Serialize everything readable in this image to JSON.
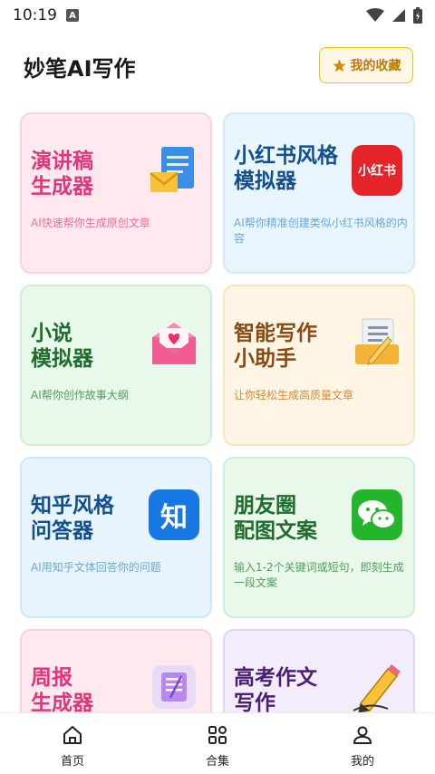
{
  "status_bar": {
    "time": "10:19",
    "notification_letter": "A"
  },
  "header": {
    "title": "妙笔AI写作",
    "favorites_label": "我的收藏"
  },
  "cards": [
    {
      "title": "演讲稿\n生成器",
      "desc": "AI快速帮你生成原创文章",
      "icon": "document-envelope-icon"
    },
    {
      "title": "小红书风格模拟器",
      "desc": "AI帮你精准创建类似小红书风格的内容",
      "icon": "xiaohongshu-icon",
      "icon_text": "小红书"
    },
    {
      "title": "小说\n模拟器",
      "desc": "AI帮你创作故事大纲",
      "icon": "love-letter-icon"
    },
    {
      "title": "智能写作\n小助手",
      "desc": "让你轻松生成高质量文章",
      "icon": "notepad-pencil-icon"
    },
    {
      "title": "知乎风格\n问答器",
      "desc": "AI用知乎文体回答你的问题",
      "icon": "zhihu-icon",
      "icon_text": "知"
    },
    {
      "title": "朋友圈\n配图文案",
      "desc": "输入1-2个关键词或短句，即刻生成一段文案",
      "icon": "wechat-icon"
    },
    {
      "title": "周报\n生成器",
      "desc": "",
      "icon": "notepad-icon"
    },
    {
      "title": "高考作文\n写作",
      "desc": "",
      "icon": "pencil-icon"
    }
  ],
  "bottom_nav": [
    {
      "label": "首页",
      "icon": "home-icon"
    },
    {
      "label": "合集",
      "icon": "grid-icon"
    },
    {
      "label": "我的",
      "icon": "person-icon"
    }
  ]
}
